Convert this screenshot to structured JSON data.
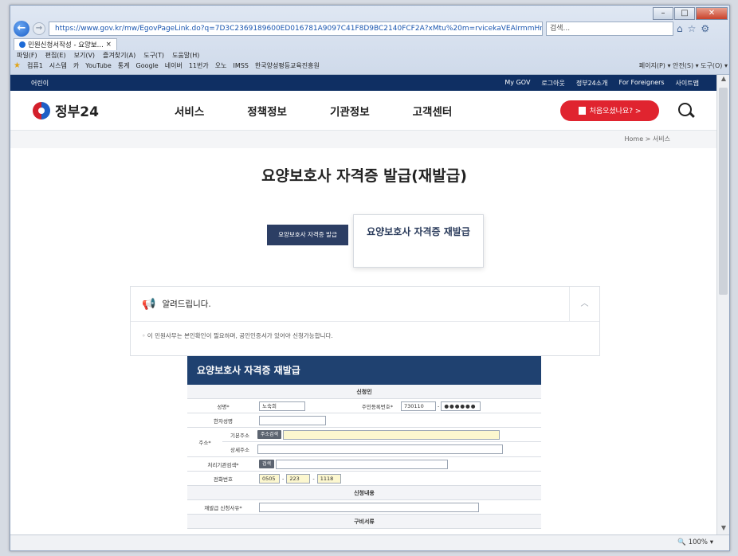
{
  "browser": {
    "url": "https://www.gov.kr/mw/EgovPageLink.do?q=7D3C2369189600ED016781A9097C41F8D9BC2140FCF2A?xMtu%20m=rvicekaVEAIrmmHrwIE",
    "search_placeholder": "검색...",
    "tab_title": "민원신청서작성 - 요양보...",
    "menu": [
      "파일(F)",
      "편집(E)",
      "보기(V)",
      "즐겨찾기(A)",
      "도구(T)",
      "도움말(H)"
    ],
    "favorites": [
      "컴퓨1",
      "시스템",
      "카",
      "YouTube",
      "통계",
      "Google",
      "네이버",
      "11번가",
      "오노",
      "IMSS",
      "한국양성평등교육진흥원"
    ],
    "toolbar_right": "페이지(P) ▾  안전(S) ▾  도구(O) ▾",
    "zoom": "100%"
  },
  "site": {
    "util_left": "어린이",
    "util_links": [
      "My GOV",
      "로그아웃",
      "정부24소개",
      "For Foreigners",
      "사이트맵"
    ],
    "logo_text": "정부24",
    "gnb": [
      "서비스",
      "정책정보",
      "기관정보",
      "고객센터"
    ],
    "first_visit": "처음오셨나요?  >",
    "breadcrumb": "Home > 서비스"
  },
  "main": {
    "title": "요양보호사 자격증 발급(재발급)",
    "tab_issue": "요양보호사 자격증 발급",
    "tab_reissue": "요양보호사 자격증 재발급",
    "notice_title": "알려드립니다.",
    "notice_text": "◦ 이 민원사무는 본인확인이 필요하며, 공인인증서가 있어야 신청가능합니다."
  },
  "form": {
    "title": "요양보호사 자격증 재발급",
    "section_applicant": "신청인",
    "name_label": "성명*",
    "name_value": "노숙희",
    "rrn_label": "주민등록번호*",
    "rrn_front": "730110",
    "rrn_back": "●●●●●●",
    "hanja_label": "한자성명",
    "address_label": "주소*",
    "base_address_label": "기본주소",
    "search_address_btn": "주소검색",
    "detail_address_label": "상세주소",
    "agency_label": "처리기관검색*",
    "agency_btn": "검색",
    "phone_label": "전화번호",
    "phone1": "0505",
    "phone2": "223",
    "phone3": "1118",
    "section_request": "신청내용",
    "reissue_reason_label": "재발급 신청사유*",
    "section_docs": "구비서류"
  }
}
